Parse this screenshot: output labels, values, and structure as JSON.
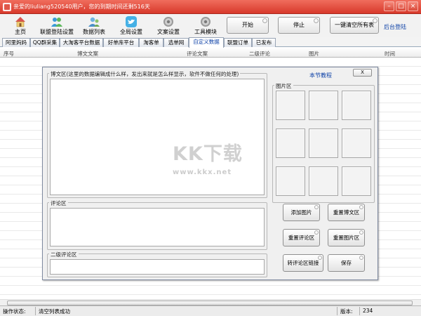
{
  "window": {
    "title": "亲爱的liuliang520540用户，您的到期时间还剩516天",
    "icon": "app-icon",
    "controls": [
      "minimize",
      "maximize",
      "close"
    ]
  },
  "toolbar": {
    "tools": [
      {
        "label": "主页",
        "icon": "home-icon"
      },
      {
        "label": "联盟登陆设置",
        "icon": "users-icon"
      },
      {
        "label": "数据列表",
        "icon": "contacts-icon"
      },
      {
        "label": "全局设置",
        "icon": "twitter-bird-icon"
      },
      {
        "label": "文案设置",
        "icon": "gear-icon"
      },
      {
        "label": "工具模块",
        "icon": "gear-icon"
      }
    ],
    "buttons": {
      "start": "开始",
      "stop": "停止",
      "clear_all": "一键清空所有表"
    },
    "backend_link": "后台登陆"
  },
  "tabs": [
    {
      "label": "阿里妈妈",
      "active": false
    },
    {
      "label": "QQ群采集",
      "active": false
    },
    {
      "label": "大淘客平台数据",
      "active": false
    },
    {
      "label": "好单库平台",
      "active": false
    },
    {
      "label": "淘客单",
      "active": false
    },
    {
      "label": "选单网",
      "active": false
    },
    {
      "label": "自定义数据",
      "active": true
    },
    {
      "label": "联盟订单",
      "active": false
    },
    {
      "label": "已发布",
      "active": false
    }
  ],
  "grid": {
    "columns": [
      "序号",
      "博文文案",
      "评论文案",
      "二级评论",
      "图片",
      "时间"
    ]
  },
  "dialog": {
    "tutorial_link": "本节教程",
    "close_label": "X",
    "post_section": {
      "legend": "博文区(这里的数据编辑成什么样，发出来就是怎么样显示，软件不做任何的处理)",
      "value": ""
    },
    "image_section": {
      "legend": "图片区",
      "slot_count": 9
    },
    "comment_section": {
      "legend": "评论区",
      "value": ""
    },
    "second_comment_section": {
      "legend": "二级评论区",
      "value": ""
    },
    "buttons": {
      "add_image": "添加图片",
      "reset_post": "重置博文区",
      "reset_comment": "重置评论区",
      "reset_image": "重置图片区",
      "convert_link": "转评论区链接",
      "save": "保存"
    }
  },
  "watermark": {
    "main": "KK下载",
    "url": "www.kkx.net"
  },
  "statusbar": {
    "label": "操作状态:",
    "status": "清空列表成功",
    "version_label": "版本:",
    "version": "234"
  },
  "colors": {
    "titlebar": "#e04a3a",
    "accent_link": "#0b3fa6"
  }
}
